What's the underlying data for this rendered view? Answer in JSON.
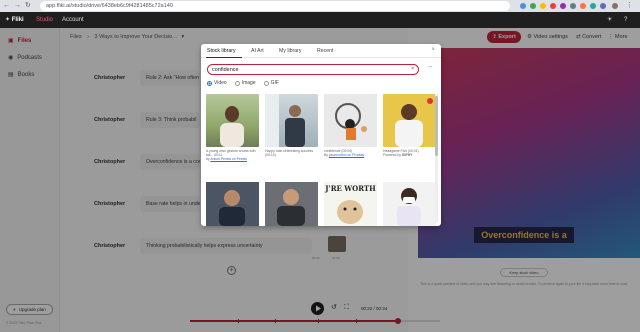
{
  "browser": {
    "url": "app.fliki.ai/studio/drive/6438eb6c9f4281485c72a140",
    "nav": {
      "back": "←",
      "forward": "→",
      "reload": "↻"
    }
  },
  "topbar": {
    "logo": "Fliki",
    "tabs": [
      "Studio",
      "Account"
    ]
  },
  "sidebar": {
    "items": [
      {
        "label": "Files",
        "icon": "folder-icon"
      },
      {
        "label": "Podcasts",
        "icon": "microphone-icon"
      },
      {
        "label": "Books",
        "icon": "book-icon"
      }
    ],
    "upgrade_label": "Upgrade plan",
    "copyright": "© 2023 Fliki, Pros Plus"
  },
  "editor": {
    "breadcrumb": [
      "Files",
      "›",
      "3 Ways to Improve Your Decisio...",
      "▾"
    ],
    "rows": [
      {
        "speaker": "Christopher",
        "text": "Rule 2: Ask \"How often"
      },
      {
        "speaker": "Christopher",
        "text": "Rule 3: Think probabil"
      },
      {
        "speaker": "Christopher",
        "text": "Overconfidence is a com"
      },
      {
        "speaker": "Christopher",
        "text": "Base rate helps in unde"
      },
      {
        "speaker": "Christopher",
        "text": "Thinking probabilistically helps express uncertainty"
      }
    ],
    "thumb_captions": [
      "00:00",
      "00:00"
    ],
    "add_symbol": "+"
  },
  "actions": {
    "export": "Export",
    "video_settings": "Video settings",
    "convert": "Convert",
    "more": "More"
  },
  "preview": {
    "caption": "Overconfidence is a",
    "keep_video": "Keep stock video",
    "note": "This is a quick preview of video and you may see flickering or audio breaks. To preview again in your file it may take more time to load."
  },
  "player": {
    "time": "00:22 / 00:34",
    "progress": 0.83
  },
  "modal": {
    "tabs": [
      "Stock library",
      "AI Art",
      "My library",
      "Recent"
    ],
    "active_tab": "Stock library",
    "close": "×",
    "search_value": "confidence",
    "clear": "×",
    "submit": "→",
    "media_types": [
      "Video",
      "Image",
      "GIF"
    ],
    "selected_media": "Video",
    "results": [
      {
        "caption": "A young man gesture shows with tall...",
        "credit_prefix": "by",
        "credit": "Antoni Pexels on Pexels",
        "duration": "00:11"
      },
      {
        "caption": "Happy man celebrating success (00:14)",
        "credit_prefix": "",
        "credit": "",
        "duration": ""
      },
      {
        "caption": "confidence (00:04)",
        "credit_prefix": "By",
        "credit": "jotunmotion on Pixabay",
        "duration": ""
      },
      {
        "caption": "Headgame Fish (00:01)",
        "credit_prefix": "Powered by",
        "credit": "GIPHY",
        "duration": ""
      }
    ],
    "row2_text": "J'RE WORTH"
  }
}
